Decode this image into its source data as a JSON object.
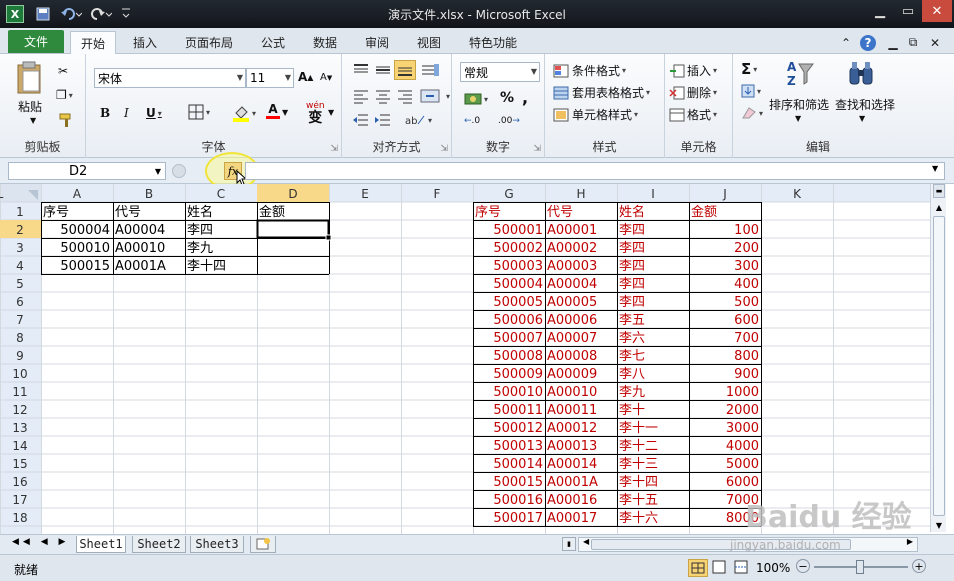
{
  "window": {
    "title": "演示文件.xlsx - Microsoft Excel",
    "logo": "X",
    "quick_access": [
      "save-icon",
      "undo-icon",
      "redo-icon",
      "customize-icon"
    ],
    "controls": [
      "minimize-icon",
      "maximize-icon",
      "close-icon"
    ]
  },
  "menu": {
    "file": "文件",
    "tabs": [
      "开始",
      "插入",
      "页面布局",
      "公式",
      "数据",
      "审阅",
      "视图",
      "特色功能"
    ],
    "active": "开始"
  },
  "ribbon": {
    "clipboard": {
      "paste": "粘贴",
      "label": "剪贴板"
    },
    "font": {
      "name": "宋体",
      "size": "11",
      "label": "字体",
      "bold": "B",
      "italic": "I",
      "underline": "U",
      "grow": "A",
      "shrink": "A",
      "fontcolor": "A",
      "wen": "wén",
      "wen_char": "变"
    },
    "alignment": {
      "label": "对齐方式"
    },
    "number": {
      "format": "常规",
      "label": "数字",
      "percent": "%",
      "comma": ",",
      "inc": ".0",
      "dec": ".00"
    },
    "styles": {
      "conditional": "条件格式",
      "table": "套用表格格式",
      "cell": "单元格样式",
      "label": "样式"
    },
    "cells": {
      "insert": "插入",
      "delete": "删除",
      "format": "格式",
      "label": "单元格"
    },
    "editing": {
      "sum": "Σ",
      "sort": "排序和筛选",
      "find": "查找和选择",
      "label": "编辑"
    }
  },
  "formula_bar": {
    "name_box": "D2",
    "fx": "fx",
    "content": ""
  },
  "sheet": {
    "columns": [
      "A",
      "B",
      "C",
      "D",
      "E",
      "F",
      "G",
      "H",
      "I",
      "J",
      "K",
      "L"
    ],
    "rows": [
      "1",
      "2",
      "3",
      "4",
      "5",
      "6",
      "7",
      "8",
      "9",
      "10",
      "11",
      "12",
      "13",
      "14",
      "15",
      "16",
      "17",
      "18"
    ],
    "left_table": [
      [
        "序号",
        "代号",
        "姓名",
        "金额"
      ],
      [
        "500004",
        "A00004",
        "李四",
        ""
      ],
      [
        "500010",
        "A00010",
        "李九",
        ""
      ],
      [
        "500015",
        "A0001A",
        "李十四",
        ""
      ]
    ],
    "right_table": [
      [
        "序号",
        "代号",
        "姓名",
        "金额"
      ],
      [
        "500001",
        "A00001",
        "李四",
        "100"
      ],
      [
        "500002",
        "A00002",
        "李四",
        "200"
      ],
      [
        "500003",
        "A00003",
        "李四",
        "300"
      ],
      [
        "500004",
        "A00004",
        "李四",
        "400"
      ],
      [
        "500005",
        "A00005",
        "李四",
        "500"
      ],
      [
        "500006",
        "A00006",
        "李五",
        "600"
      ],
      [
        "500007",
        "A00007",
        "李六",
        "700"
      ],
      [
        "500008",
        "A00008",
        "李七",
        "800"
      ],
      [
        "500009",
        "A00009",
        "李八",
        "900"
      ],
      [
        "500010",
        "A00010",
        "李九",
        "1000"
      ],
      [
        "500011",
        "A00011",
        "李十",
        "2000"
      ],
      [
        "500012",
        "A00012",
        "李十一",
        "3000"
      ],
      [
        "500013",
        "A00013",
        "李十二",
        "4000"
      ],
      [
        "500014",
        "A00014",
        "李十三",
        "5000"
      ],
      [
        "500015",
        "A0001A",
        "李十四",
        "6000"
      ],
      [
        "500016",
        "A00016",
        "李十五",
        "7000"
      ],
      [
        "500017",
        "A00017",
        "李十六",
        "8000"
      ]
    ],
    "selected": "D2",
    "red": "#c00000"
  },
  "sheet_tabs": [
    "Sheet1",
    "Sheet2",
    "Sheet3"
  ],
  "status": {
    "ready": "就绪",
    "zoom": "100%",
    "minus": "−",
    "plus": "+"
  },
  "watermark": {
    "brand": "Baidu 经验",
    "url": "jingyan.baidu.com"
  }
}
